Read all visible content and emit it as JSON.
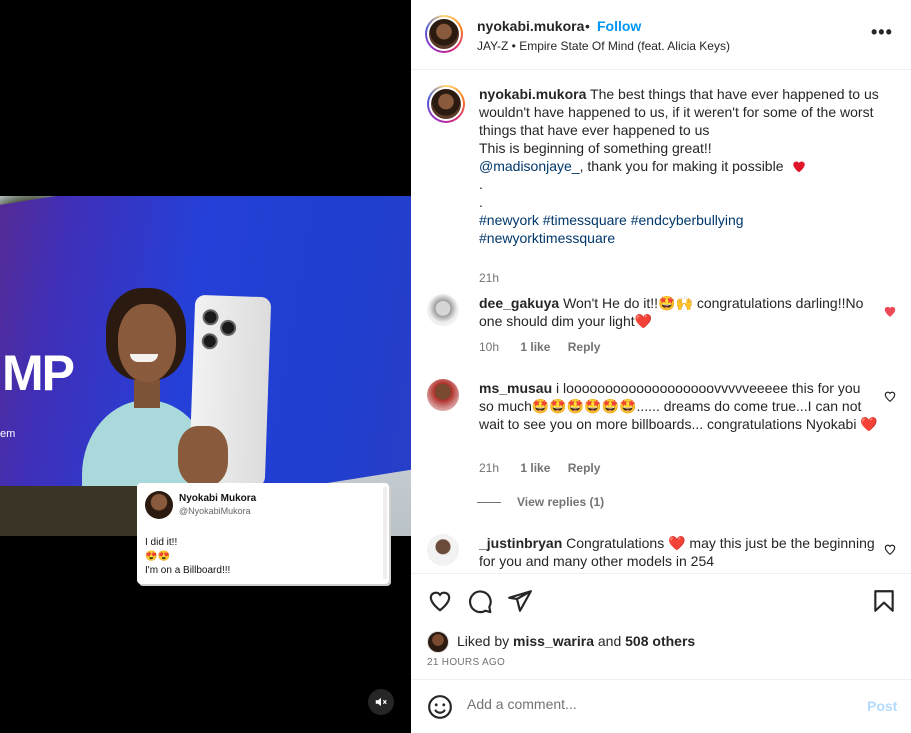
{
  "post": {
    "username": "nyokabi.mukora",
    "separator": "•",
    "follow_label": "Follow",
    "music": "JAY-Z • Empire State Of Mind (feat. Alicia Keys)",
    "more_label": "•••",
    "caption_username": "nyokabi.mukora",
    "caption_line1": "The best things that have ever happened to us wouldn't have happened to us, if it weren't for some of the worst things that have ever happened to us",
    "caption_line2": "This is beginning of something great!!",
    "caption_mention": "@madisonjaye_",
    "caption_thanks": ", thank you for making it possible",
    "caption_dot": ".",
    "hashtags_line1": "#newyork #timessquare #endcyberbullying",
    "hashtags_line2": "#newyorktimessquare",
    "caption_time": "21h"
  },
  "media": {
    "billboard_text": "MP",
    "billboard_sub": "em",
    "tweet": {
      "name": "Nyokabi Mukora",
      "handle": "@NyokabiMukora",
      "text": "I did it!!\n😍😍\nI'm on a Billboard!!!"
    },
    "mute_icon": "speaker-muted-icon"
  },
  "comments": [
    {
      "username": "dee_gakuya",
      "text": "Won't He do it!!🤩🙌 congratulations darling!!No one should dim your light❤️",
      "time": "10h",
      "likes": "1 like",
      "reply": "Reply",
      "liked": true
    },
    {
      "username": "ms_musau",
      "text": "i looooooooooooooooooovvvvveeeee this for you so much🤩🤩🤩🤩🤩🤩...... dreams do come true...I can not wait to see you on more billboards... congratulations Nyokabi ❤️",
      "time": "21h",
      "likes": "1 like",
      "reply": "Reply",
      "liked": false,
      "view_replies": "View replies (1)"
    },
    {
      "username": "_justinbryan",
      "text": "Congratulations ❤️ may this just be the beginning for you and many other models in 254",
      "liked": false
    }
  ],
  "actions": {
    "liked_by_prefix": "Liked by",
    "liked_by_user": "miss_warira",
    "and_label": "and",
    "others": "508 others",
    "timestamp": "21 HOURS AGO"
  },
  "add_comment": {
    "placeholder": "Add a comment...",
    "post_label": "Post"
  },
  "colors": {
    "accent_blue": "#0095f6",
    "link": "#00376b",
    "like_red": "#ed4956",
    "muted_text": "#737373",
    "post_disabled": "#b3dbff"
  }
}
